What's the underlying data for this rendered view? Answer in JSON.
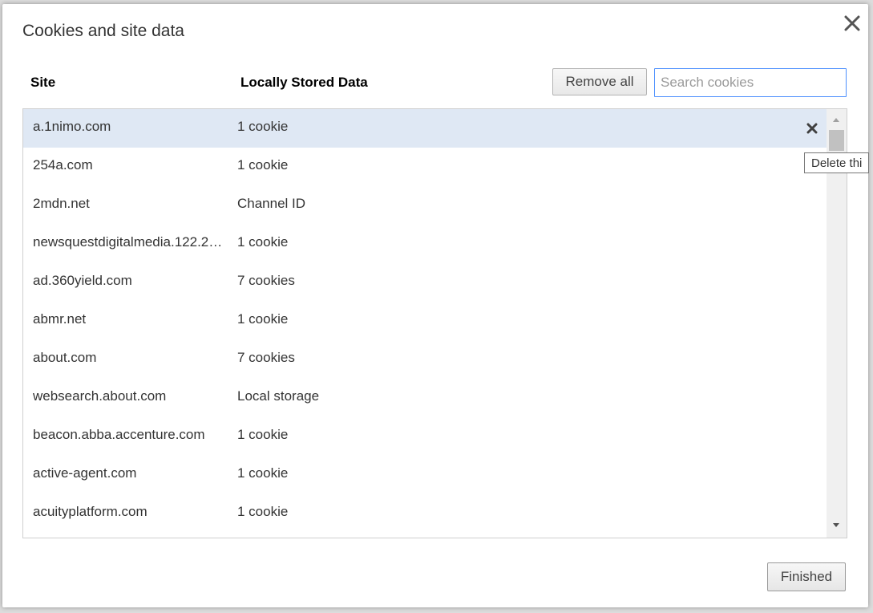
{
  "dialog": {
    "title": "Cookies and site data",
    "close_icon": "close-icon"
  },
  "header": {
    "site_label": "Site",
    "data_label": "Locally Stored Data",
    "remove_all_label": "Remove all",
    "search_placeholder": "Search cookies",
    "search_value": ""
  },
  "rows": [
    {
      "site": "a.1nimo.com",
      "data": "1 cookie",
      "selected": true
    },
    {
      "site": "254a.com",
      "data": "1 cookie"
    },
    {
      "site": "2mdn.net",
      "data": "Channel ID"
    },
    {
      "site": "newsquestdigitalmedia.122.2…",
      "data": "1 cookie"
    },
    {
      "site": "ad.360yield.com",
      "data": "7 cookies"
    },
    {
      "site": "abmr.net",
      "data": "1 cookie"
    },
    {
      "site": "about.com",
      "data": "7 cookies"
    },
    {
      "site": "websearch.about.com",
      "data": "Local storage"
    },
    {
      "site": "beacon.abba.accenture.com",
      "data": "1 cookie"
    },
    {
      "site": "active-agent.com",
      "data": "1 cookie"
    },
    {
      "site": "acuityplatform.com",
      "data": "1 cookie"
    }
  ],
  "row_delete_icon": "close-icon",
  "tooltip": "Delete thi",
  "footer": {
    "finished_label": "Finished"
  },
  "colors": {
    "selected_row": "#dfe8f4",
    "search_focus_border": "#4d90fe"
  }
}
